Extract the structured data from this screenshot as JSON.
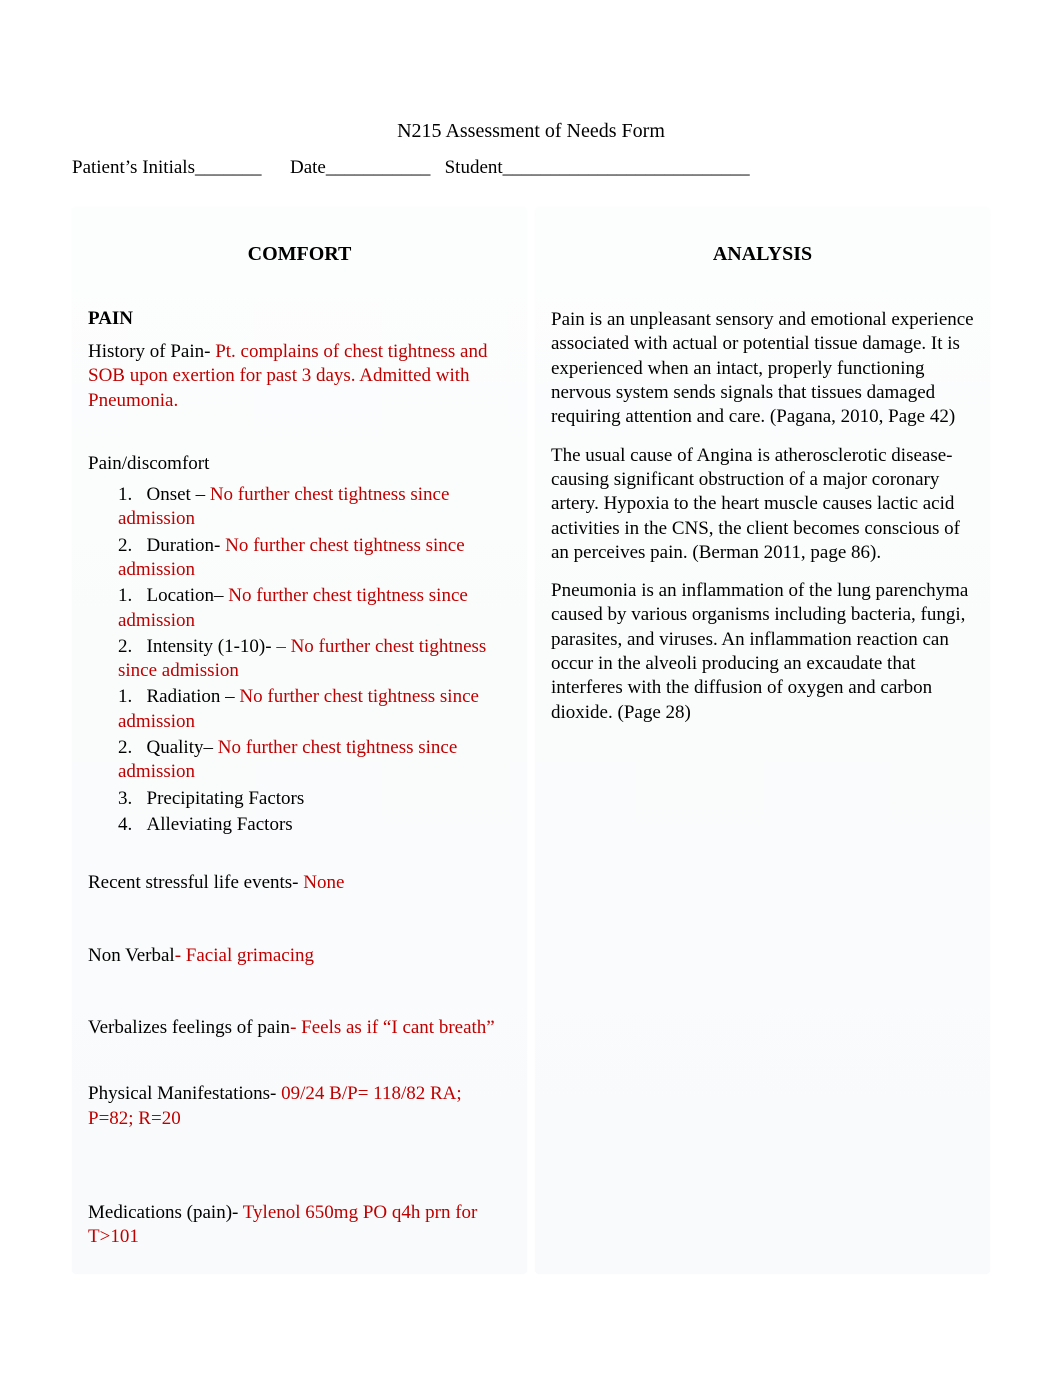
{
  "title": "N215 Assessment of Needs Form",
  "header": {
    "initials_label": "Patient’s Initials_______",
    "date_label": "Date___________",
    "student_label": "Student__________________________"
  },
  "columns": {
    "left_header": "COMFORT",
    "right_header": "ANALYSIS"
  },
  "comfort": {
    "pain_label": "PAIN",
    "history_label": "History of Pain- ",
    "history_value": "Pt. complains of chest tightness and SOB upon exertion for past 3 days. Admitted with Pneumonia.",
    "pain_discomfort_label": "Pain/discomfort",
    "items": [
      {
        "num": "1.",
        "label": "Onset – ",
        "value": "No further chest tightness since admission"
      },
      {
        "num": "2.",
        "label": "Duration- ",
        "value": "No further chest tightness since admission"
      },
      {
        "num": "1.",
        "label": "Location– ",
        "value": "No further chest tightness since admission"
      },
      {
        "num": "2.",
        "label": "Intensity (1-10)- ",
        "value": " – No further chest tightness since admission"
      },
      {
        "num": "1.",
        "label": "Radiation – ",
        "value": "No further chest tightness since admission"
      },
      {
        "num": "2.",
        "label": "Quality– ",
        "value": "No further chest tightness since admission"
      },
      {
        "num": "3.",
        "label": "Precipitating Factors",
        "value": ""
      },
      {
        "num": "4.",
        "label": "Alleviating Factors",
        "value": ""
      }
    ],
    "recent_label": "Recent stressful life events- ",
    "recent_value": "None",
    "nonverbal_label": "Non Verbal",
    "nonverbal_value": "- Facial grimacing",
    "verbalizes_label": "Verbalizes feelings of pain",
    "verbalizes_value": "- Feels as if  “I cant breath”",
    "physical_label": "Physical Manifestations- ",
    "physical_value": "09/24 B/P= 118/82 RA; P=82; R=20",
    "medications_label": "Medications (pain)- ",
    "medications_value": "Tylenol 650mg PO q4h prn for T>101"
  },
  "analysis": {
    "p1": "Pain is an unpleasant sensory and emotional experience associated with actual or potential tissue damage. It is experienced when an intact, properly functioning nervous system sends signals that tissues damaged requiring attention and care. (Pagana, 2010, Page 42)",
    "p2": "The usual cause of Angina is atherosclerotic disease- causing significant obstruction of a major coronary artery. Hypoxia to the heart muscle causes lactic acid activities in the CNS, the client becomes conscious of an perceives pain. (Berman 2011, page 86).",
    "p3": "Pneumonia is an inflammation of the lung parenchyma caused by various organisms including bacteria, fungi, parasites, and viruses. An inflammation reaction can occur in the alveoli producing an excaudate that interferes with the diffusion of oxygen and carbon dioxide. (Page 28)"
  }
}
